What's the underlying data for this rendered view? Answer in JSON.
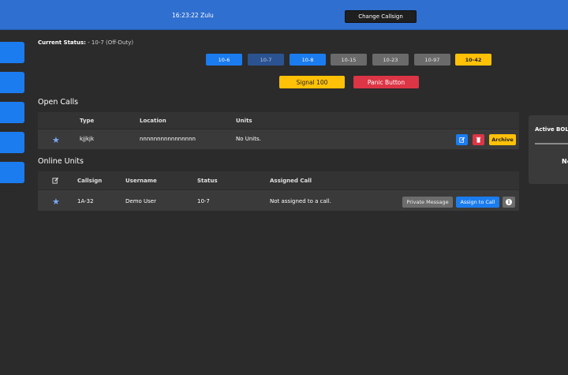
{
  "header": {
    "clock": "16:23:22 Zulu",
    "change_callsign_label": "Change Callsign"
  },
  "status": {
    "label": "Current Status:",
    "value": " - 10-7 (Off-Duty)"
  },
  "codes": [
    "10-6",
    "10-7",
    "10-8",
    "10-15",
    "10-23",
    "10-97",
    "10-42"
  ],
  "actions": {
    "signal_label": "Signal 100",
    "panic_label": "Panic Button"
  },
  "open_calls": {
    "title": "Open Calls",
    "columns": [
      "Type",
      "Location",
      "Units"
    ],
    "rows": [
      {
        "type": "kjjkjk",
        "location": "nnnnnnnnnnnnnnnn",
        "units": "No Units.",
        "archive_label": "Archive"
      }
    ]
  },
  "online_units": {
    "title": "Online Units",
    "columns": [
      "Callsign",
      "Username",
      "Status",
      "Assigned Call"
    ],
    "rows": [
      {
        "callsign": "1A-32",
        "username": "Demo User",
        "status": "10-7",
        "assigned_call": "Not assigned to a call.",
        "private_message_label": "Private Message",
        "assign_label": "Assign to Call"
      }
    ]
  },
  "bolo": {
    "title": "Active BOLOs",
    "text": "No"
  },
  "colors": {
    "topbar": "#2f6fcf",
    "primary": "#1b7cf0",
    "warning": "#ffc107",
    "danger": "#dc3545",
    "background": "#2b2b2b",
    "panel": "#3a3a3a"
  },
  "icons": {
    "row_star": "star-icon",
    "edit": "edit-icon",
    "delete": "trash-icon",
    "info": "info-icon"
  }
}
